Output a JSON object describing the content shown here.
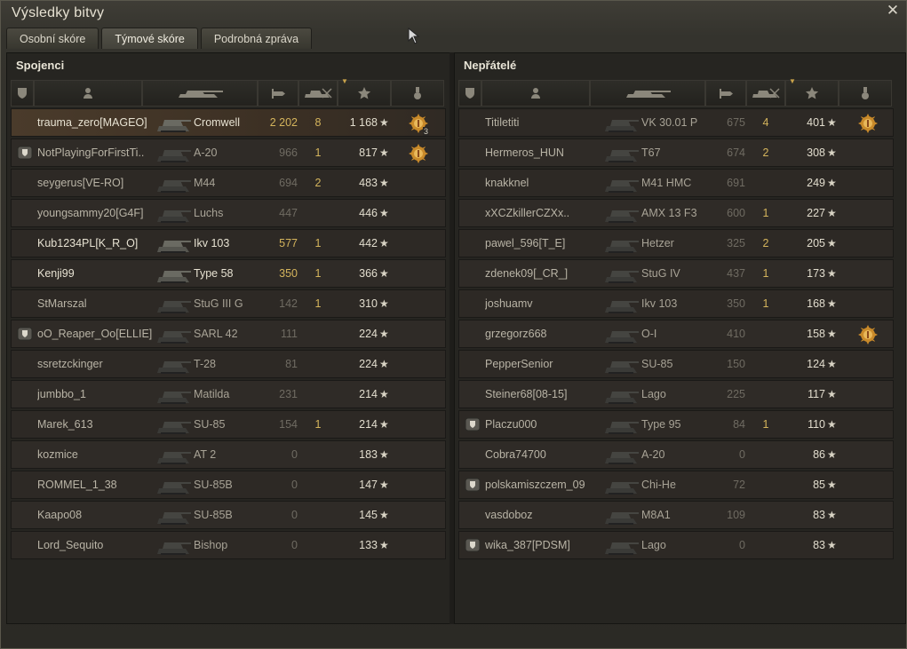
{
  "window": {
    "title": "Výsledky bitvy"
  },
  "tabs": [
    {
      "label": "Osobní skóre"
    },
    {
      "label": "Týmové skóre"
    },
    {
      "label": "Podrobná zpráva"
    }
  ],
  "allies": {
    "title": "Spojenci",
    "rows": [
      {
        "player": "trauma_zero[MAGEO]",
        "vehicle": "Cromwell",
        "damage": "2 202",
        "kills": "8",
        "xp": "1 168",
        "medal": "3"
      },
      {
        "player": "NotPlayingForFirstTi..",
        "vehicle": "A-20",
        "damage": "966",
        "kills": "1",
        "xp": "817",
        "medal": ""
      },
      {
        "player": "seygerus[VE-RO]",
        "vehicle": "M44",
        "damage": "694",
        "kills": "2",
        "xp": "483"
      },
      {
        "player": "youngsammy20[G4F]",
        "vehicle": "Luchs",
        "damage": "447",
        "kills": "",
        "xp": "446"
      },
      {
        "player": "Kub1234PL[K_R_O]",
        "vehicle": "Ikv 103",
        "damage": "577",
        "kills": "1",
        "xp": "442"
      },
      {
        "player": "Kenji99",
        "vehicle": "Type 58",
        "damage": "350",
        "kills": "1",
        "xp": "366"
      },
      {
        "player": "StMarszal",
        "vehicle": "StuG III G",
        "damage": "142",
        "kills": "1",
        "xp": "310"
      },
      {
        "player": "oO_Reaper_Oo[ELLIE]",
        "vehicle": "SARL 42",
        "damage": "111",
        "kills": "",
        "xp": "224"
      },
      {
        "player": "ssretzckinger",
        "vehicle": "T-28",
        "damage": "81",
        "kills": "",
        "xp": "224"
      },
      {
        "player": "jumbbo_1",
        "vehicle": "Matilda",
        "damage": "231",
        "kills": "",
        "xp": "214"
      },
      {
        "player": "Marek_613",
        "vehicle": "SU-85",
        "damage": "154",
        "kills": "1",
        "xp": "214"
      },
      {
        "player": "kozmice",
        "vehicle": "AT 2",
        "damage": "0",
        "kills": "",
        "xp": "183"
      },
      {
        "player": "ROMMEL_1_38",
        "vehicle": "SU-85B",
        "damage": "0",
        "kills": "",
        "xp": "147"
      },
      {
        "player": "Kaapo08",
        "vehicle": "SU-85B",
        "damage": "0",
        "kills": "",
        "xp": "145"
      },
      {
        "player": "Lord_Sequito",
        "vehicle": "Bishop",
        "damage": "0",
        "kills": "",
        "xp": "133"
      }
    ]
  },
  "enemies": {
    "title": "Nepřátelé",
    "rows": [
      {
        "player": "Titiletiti",
        "vehicle": "VK 30.01 P",
        "damage": "675",
        "kills": "4",
        "xp": "401"
      },
      {
        "player": "Hermeros_HUN",
        "vehicle": "T67",
        "damage": "674",
        "kills": "2",
        "xp": "308"
      },
      {
        "player": "knakknel",
        "vehicle": "M41 HMC",
        "damage": "691",
        "kills": "",
        "xp": "249"
      },
      {
        "player": "xXCZkillerCZXx..",
        "vehicle": "AMX 13 F3",
        "damage": "600",
        "kills": "1",
        "xp": "227"
      },
      {
        "player": "pawel_596[T_E]",
        "vehicle": "Hetzer",
        "damage": "325",
        "kills": "2",
        "xp": "205"
      },
      {
        "player": "zdenek09[_CR_]",
        "vehicle": "StuG IV",
        "damage": "437",
        "kills": "1",
        "xp": "173"
      },
      {
        "player": "joshuamv",
        "vehicle": "Ikv 103",
        "damage": "350",
        "kills": "1",
        "xp": "168"
      },
      {
        "player": "grzegorz668",
        "vehicle": "O-I",
        "damage": "410",
        "kills": "",
        "xp": "158"
      },
      {
        "player": "PepperSenior",
        "vehicle": "SU-85",
        "damage": "150",
        "kills": "",
        "xp": "124"
      },
      {
        "player": "Steiner68[08-15]",
        "vehicle": "Lago",
        "damage": "225",
        "kills": "",
        "xp": "117"
      },
      {
        "player": "Placzu000",
        "vehicle": "Type 95",
        "damage": "84",
        "kills": "1",
        "xp": "110"
      },
      {
        "player": "Cobra74700",
        "vehicle": "A-20",
        "damage": "0",
        "kills": "",
        "xp": "86"
      },
      {
        "player": "polskamiszczem_09",
        "vehicle": "Chi-He",
        "damage": "72",
        "kills": "",
        "xp": "85"
      },
      {
        "player": "vasdoboz",
        "vehicle": "M8A1",
        "damage": "109",
        "kills": "",
        "xp": "83"
      },
      {
        "player": "wika_387[PDSM]",
        "vehicle": "Lago",
        "damage": "0",
        "kills": "",
        "xp": "83"
      }
    ]
  },
  "icons": {
    "squad": "squad-shield-icon",
    "player": "player-icon",
    "vehicle": "tank-icon",
    "damage": "damage-shell-icon",
    "kills": "destroyed-tank-icon",
    "xp": "experience-star-icon",
    "medal": "medal-icon",
    "close": "close-icon"
  },
  "colors": {
    "gold": "#d4b45c",
    "highlight": "#4a3b2b"
  }
}
